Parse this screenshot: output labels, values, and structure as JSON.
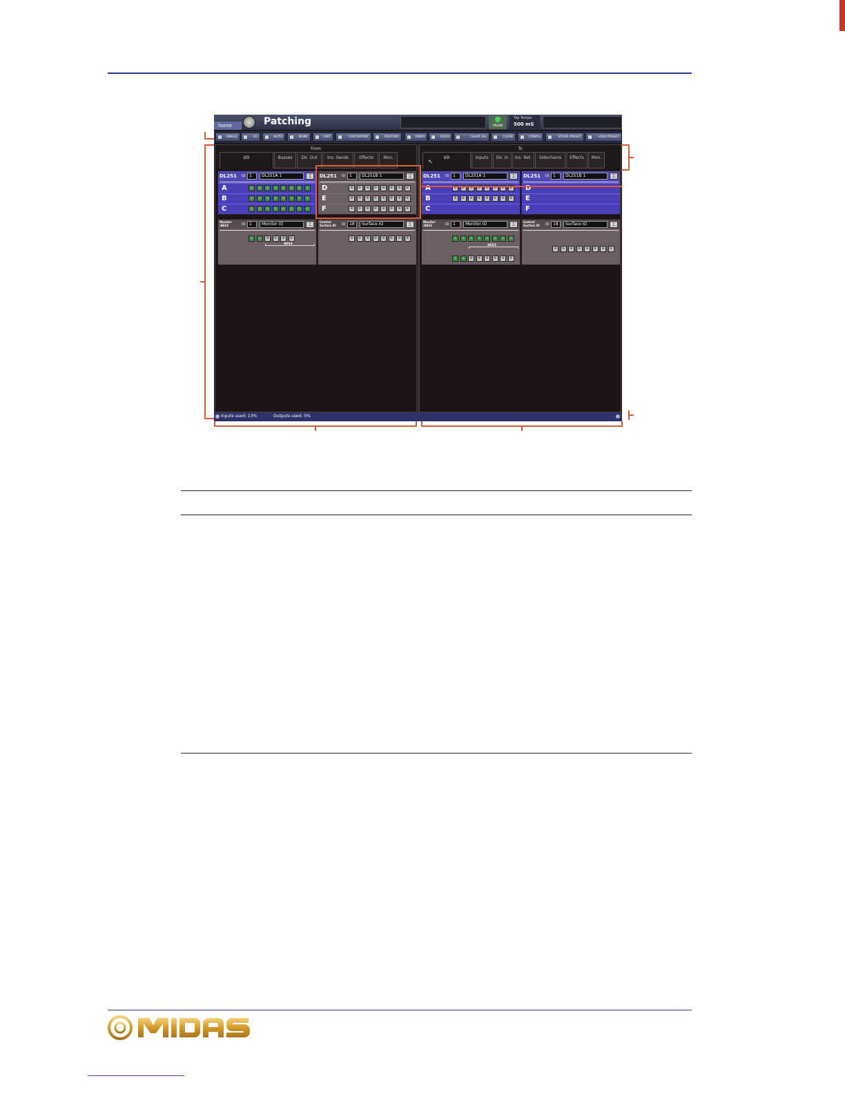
{
  "screen": {
    "home_tab": "home",
    "title": "Patching",
    "status_led_label": "ONLINE",
    "tap_tempo_label": "Tap Tempo",
    "tap_tempo_value": "500 mS",
    "toolbar": [
      "SINGLE",
      "I/O",
      "AUTO",
      "NONE",
      "UNIT",
      "CHECKPOINT",
      "RESTORE",
      "UNDO",
      "REDO",
      "CLEAR SEL",
      "CLEAR",
      "CONFIG",
      "STORE PRESET",
      "LOAD PRESET"
    ],
    "from": {
      "title": "From",
      "tabs": [
        "I/O",
        "Busses",
        "Dir. Out",
        "Ins. Sends",
        "Effects",
        "Mon."
      ],
      "rack1": {
        "model": "DL251",
        "id_label": "ID",
        "id": "1",
        "name": "DL251A 1",
        "rows": [
          "A",
          "B",
          "C"
        ]
      },
      "rack2": {
        "model": "DL251",
        "id_label": "ID",
        "id": "1",
        "name": "DL251B 1",
        "rows": [
          "D",
          "E",
          "F"
        ]
      },
      "rack3": {
        "model": "Monitor /AES3",
        "id_label": "ID",
        "id": "1",
        "name": "Monitor IO",
        "group_label": "AES3"
      },
      "rack4": {
        "model": "Control Surface IO",
        "id_label": "ID",
        "id": "18",
        "name": "Surface IO"
      }
    },
    "to": {
      "title": "To",
      "tabs": [
        "I/O",
        "Inputs",
        "Dir. In",
        "Ins. Ret.",
        "Sidechains",
        "Effects",
        "Mon."
      ],
      "rack1": {
        "model": "DL251",
        "id_label": "ID",
        "id": "1",
        "name": "DL251A 1",
        "rows": [
          "A",
          "B",
          "C"
        ]
      },
      "rack2": {
        "model": "DL251",
        "id_label": "ID",
        "id": "1",
        "name": "DL251B 1",
        "rows": [
          "D",
          "E",
          "F"
        ]
      },
      "rack3": {
        "model": "Monitor /AES3",
        "id_label": "ID",
        "id": "1",
        "name": "Monitor IO",
        "group_label": "AES3"
      },
      "rack4": {
        "model": "Control Surface IO",
        "id_label": "ID",
        "id": "18",
        "name": "Surface IO"
      }
    },
    "status": {
      "inputs": "Inputs used: 13%",
      "outputs": "Outputs used: 5%"
    }
  },
  "colors": {
    "rule": "#2b3a8c",
    "callout": "#d65a33",
    "rack_blue": "#4a3fb8",
    "socket_green": "#3c8b46"
  }
}
